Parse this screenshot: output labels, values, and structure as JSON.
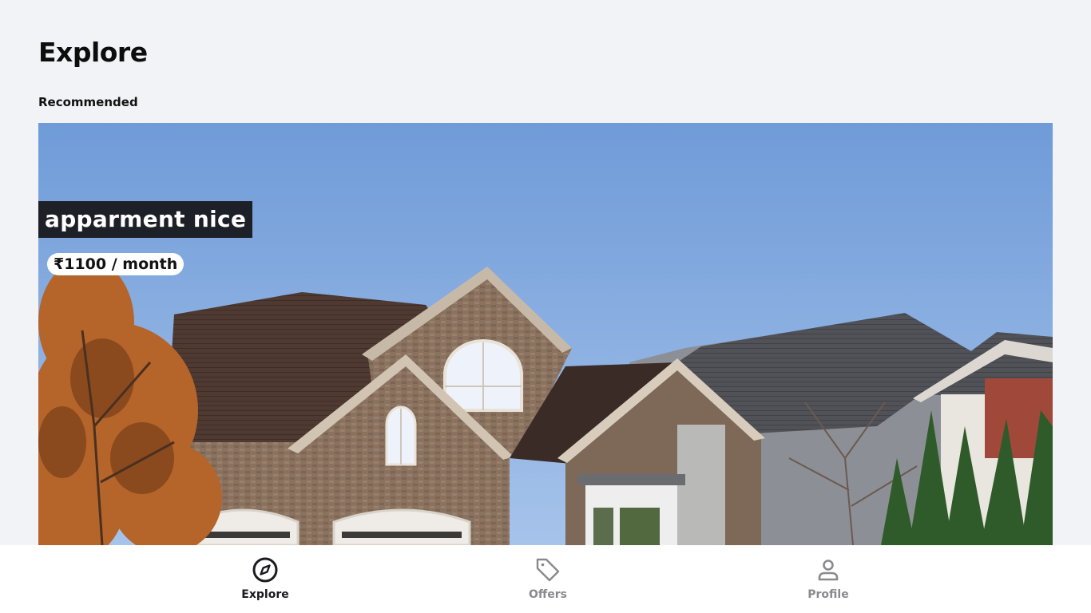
{
  "header": {
    "title": "Explore"
  },
  "section": {
    "label": "Recommended"
  },
  "listing": {
    "title": "apparment nice",
    "price": "₹1100 / month",
    "image_alt": "house-photo"
  },
  "bottom_nav": {
    "items": [
      {
        "label": "Explore",
        "icon": "compass-icon",
        "active": true
      },
      {
        "label": "Offers",
        "icon": "tag-icon",
        "active": false
      },
      {
        "label": "Profile",
        "icon": "user-icon",
        "active": false
      }
    ]
  },
  "colors": {
    "background": "#f2f3f7",
    "title_badge": "#1e2028",
    "nav_active": "#1b1b1f",
    "nav_inactive": "#8a8a8e"
  }
}
